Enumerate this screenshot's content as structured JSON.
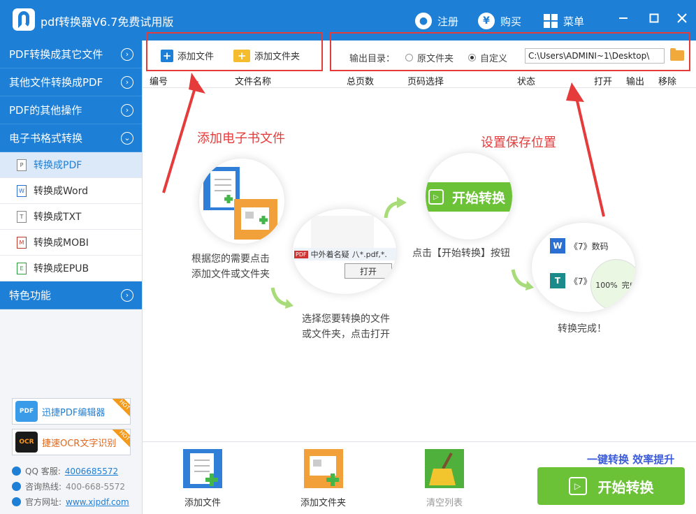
{
  "window": {
    "title": "pdf转换器V6.7免费试用版",
    "register_label": "注册",
    "buy_label": "购买",
    "menu_label": "菜单"
  },
  "sidebar": {
    "categories": [
      {
        "label": "PDF转换成其它文件"
      },
      {
        "label": "其他文件转换成PDF"
      },
      {
        "label": "PDF的其他操作"
      },
      {
        "label": "电子书格式转换"
      }
    ],
    "subitems": [
      {
        "label": "转换成PDF",
        "icon": "pdf-file-icon",
        "badge": "P"
      },
      {
        "label": "转换成Word",
        "icon": "word-file-icon",
        "badge": "W"
      },
      {
        "label": "转换成TXT",
        "icon": "txt-file-icon",
        "badge": "T"
      },
      {
        "label": "转换成MOBI",
        "icon": "mobi-file-icon",
        "badge": "M"
      },
      {
        "label": "转换成EPUB",
        "icon": "epub-file-icon",
        "badge": "E"
      }
    ],
    "special": {
      "label": "特色功能"
    },
    "promos": [
      {
        "label": "迅捷PDF编辑器",
        "badge": "HOT",
        "icon_text": "PDF"
      },
      {
        "label": "捷速OCR文字识别",
        "badge": "HOT",
        "icon_text": "OCR"
      }
    ],
    "contacts": [
      {
        "label": "QQ 客服:",
        "value": "4006685572"
      },
      {
        "label": "咨询热线:",
        "value": "400-668-5572"
      },
      {
        "label": "官方网址:",
        "value": "www.xjpdf.com"
      }
    ]
  },
  "toolbar": {
    "add_file": "添加文件",
    "add_folder": "添加文件夹",
    "output_label": "输出目录：",
    "radio_original": "原文件夹",
    "radio_custom": "自定义",
    "output_path": "C:\\Users\\ADMINI~1\\Desktop\\"
  },
  "table": {
    "columns": [
      "编号",
      "文件名称",
      "总页数",
      "页码选择",
      "状态",
      "打开",
      "输出",
      "移除"
    ]
  },
  "guide": {
    "anno_add": "添加电子书文件",
    "anno_save": "设置保存位置",
    "step1_line1": "根据您的需要点击",
    "step1_line2": "添加文件或文件夹",
    "step2_line1": "选择您要转换的文件",
    "step2_line2": "或文件夹，点击打开",
    "step3": "点击【开始转换】按钮",
    "step4": "转换完成！",
    "bubble2_file": "中外着名疑",
    "bubble2_filter": "八*.pdf,*.",
    "bubble2_open": "打开",
    "bubble3_btn": "开始转换",
    "bubble4_row1": "《7》数码",
    "bubble4_row2": "《7》",
    "bubble4_progress": "100%",
    "bubble4_done": "完成"
  },
  "bottom": {
    "add_file": "添加文件",
    "add_folder": "添加文件夹",
    "clear_list": "清空列表",
    "slogan": "一键转换  效率提升",
    "start": "开始转换"
  },
  "colors": {
    "primary": "#1e7fd6",
    "accent_green": "#6cc237",
    "annotation_red": "#e63b3b"
  }
}
